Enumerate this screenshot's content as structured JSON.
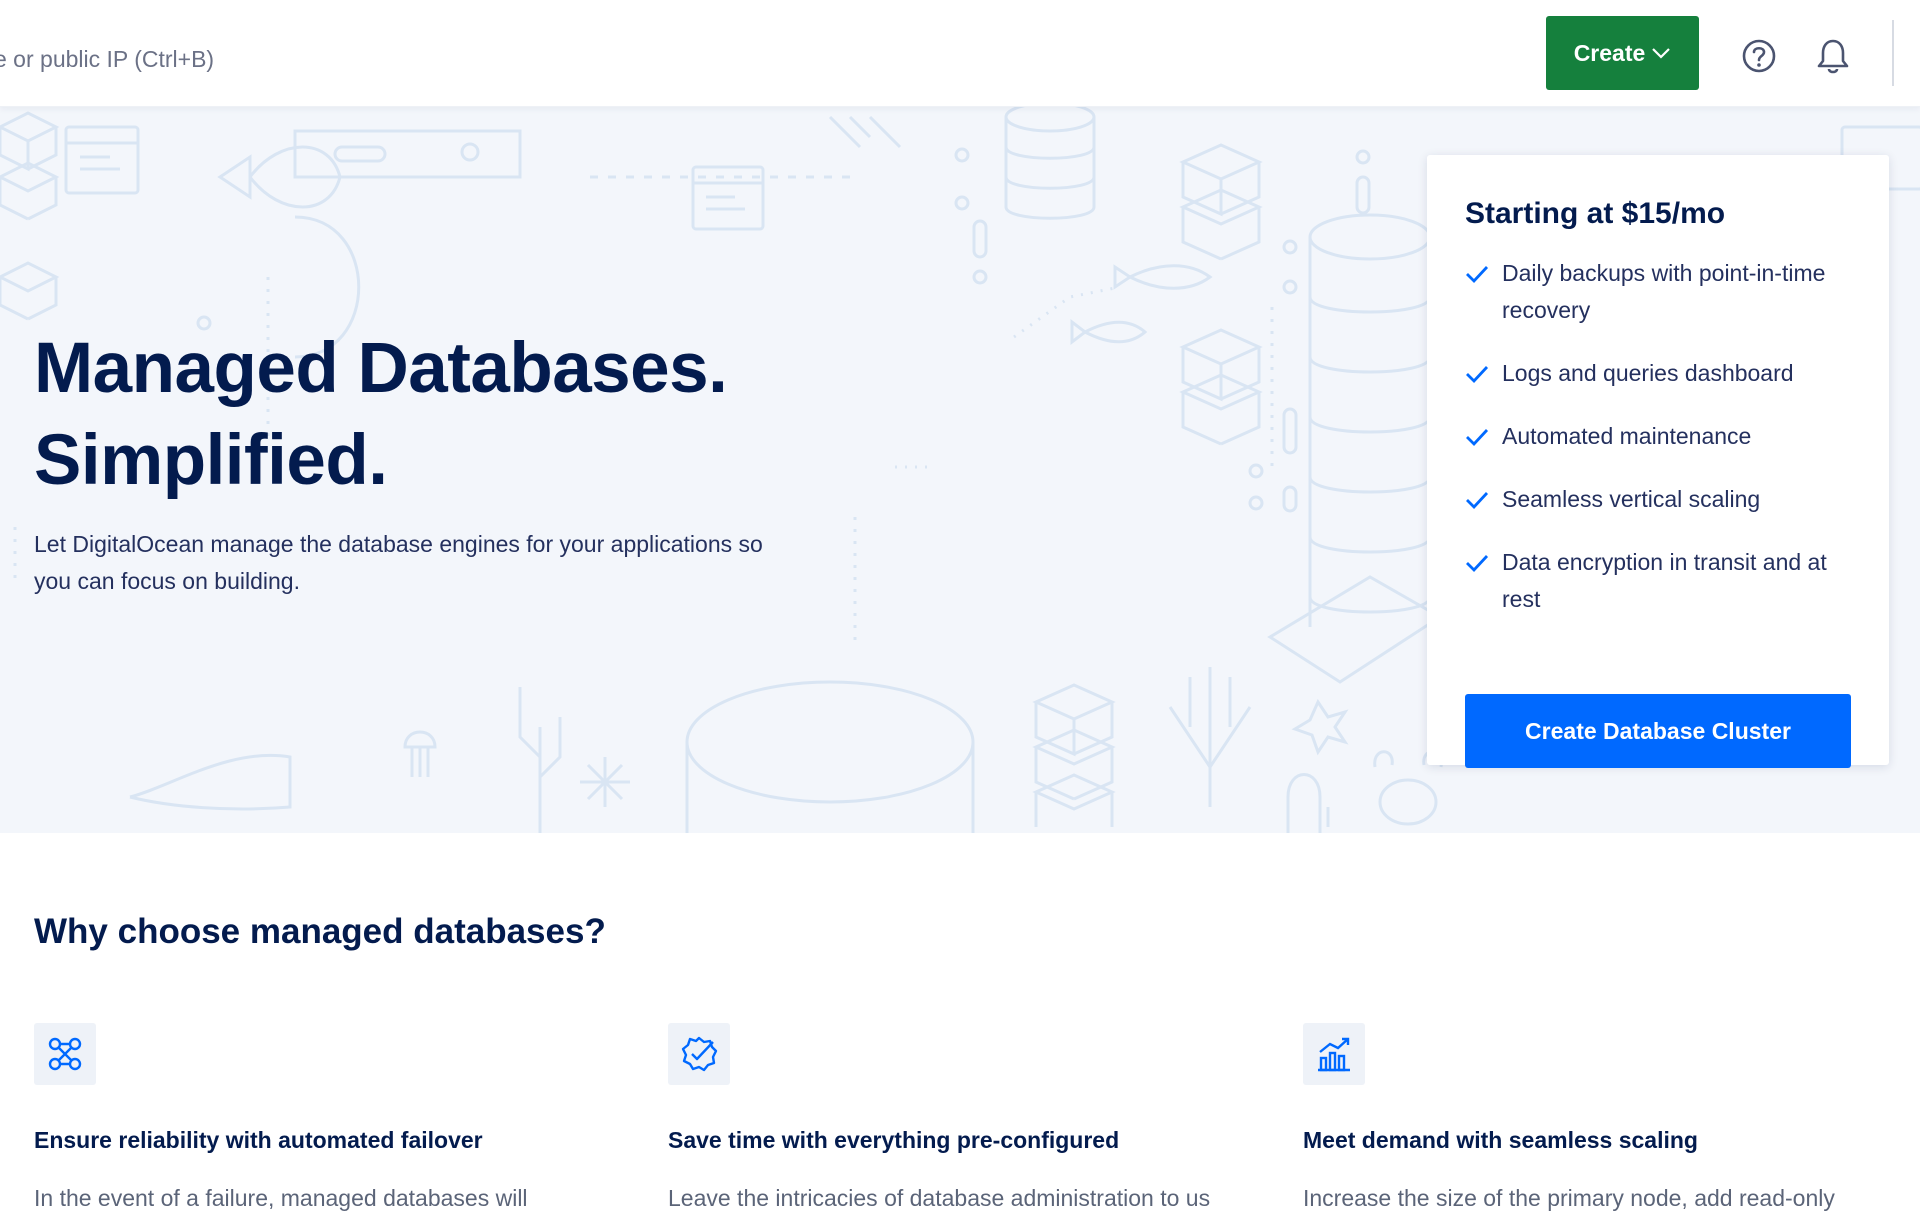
{
  "topbar": {
    "search_placeholder": "e or public IP (Ctrl+B)",
    "create_label": "Create",
    "icons": [
      "help-icon",
      "bell-icon",
      "chevron-down-icon"
    ]
  },
  "hero": {
    "title_line1": "Managed Databases.",
    "title_line2": "Simplified.",
    "description": "Let DigitalOcean manage the database engines for your applications so you can focus on building."
  },
  "pricing": {
    "title": "Starting at $15/mo",
    "features": [
      "Daily backups with point-in-time recovery",
      "Logs and queries dashboard",
      "Automated maintenance",
      "Seamless vertical scaling",
      "Data encryption in transit and at rest"
    ],
    "cta_label": "Create Database Cluster"
  },
  "why": {
    "title": "Why choose managed databases?",
    "benefits": [
      {
        "icon": "failover-nodes-icon",
        "title": "Ensure reliability with automated failover",
        "text": "In the event of a failure, managed databases will"
      },
      {
        "icon": "badge-check-icon",
        "title": "Save time with everything pre-configured",
        "text": "Leave the intricacies of database administration to us"
      },
      {
        "icon": "growth-chart-icon",
        "title": "Meet demand with seamless scaling",
        "text": "Increase the size of the primary node, add read-only"
      }
    ]
  },
  "colors": {
    "brand_blue": "#0069ff",
    "create_green": "#15803d",
    "navy_text": "#031b4e",
    "hero_bg": "#f3f6fb"
  }
}
